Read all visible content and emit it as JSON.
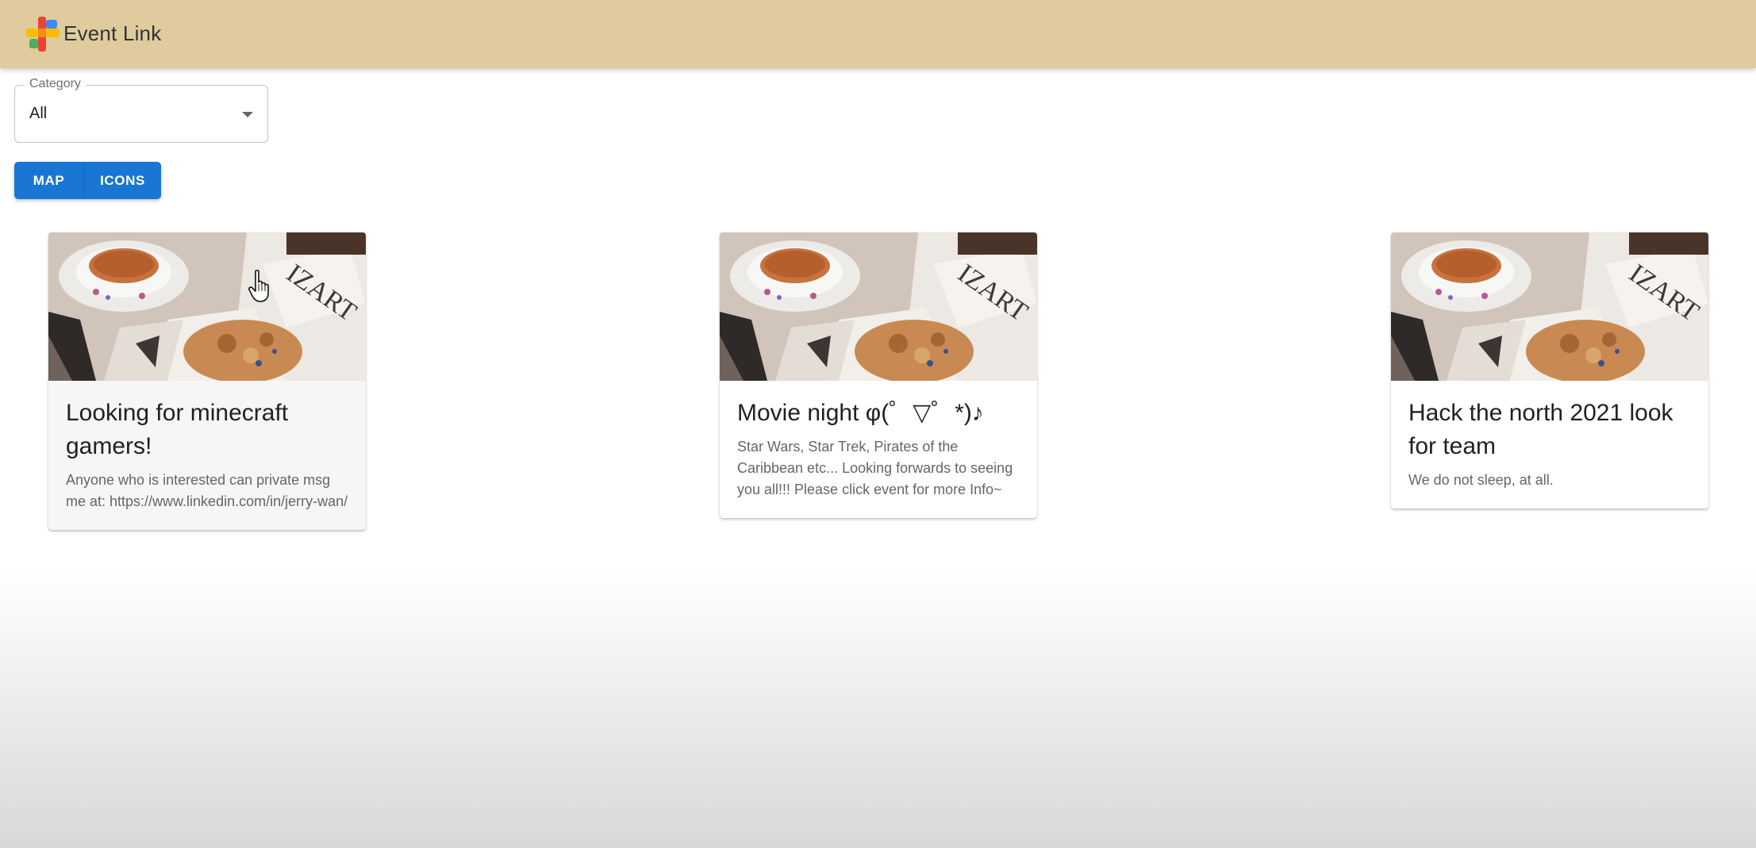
{
  "app": {
    "title": "Event Link"
  },
  "filter": {
    "label": "Category",
    "value": "All"
  },
  "view_buttons": {
    "map": "MAP",
    "icons": "ICONS"
  },
  "colors": {
    "appbar": "#dfcb9d",
    "primary": "#1976d2"
  },
  "events": [
    {
      "title": "Looking for minecraft gamers!",
      "description": "Anyone who is interested can private msg me at: https://www.linkedin.com/in/jerry-wan/"
    },
    {
      "title": "Movie night φ(゜▽゜*)♪",
      "description": "Star Wars, Star Trek, Pirates of the Caribbean etc... Looking forwards to seeing you all!!! Please click event for more Info~"
    },
    {
      "title": "Hack the north 2021 look for team",
      "description": "We do not sleep, at all."
    }
  ]
}
